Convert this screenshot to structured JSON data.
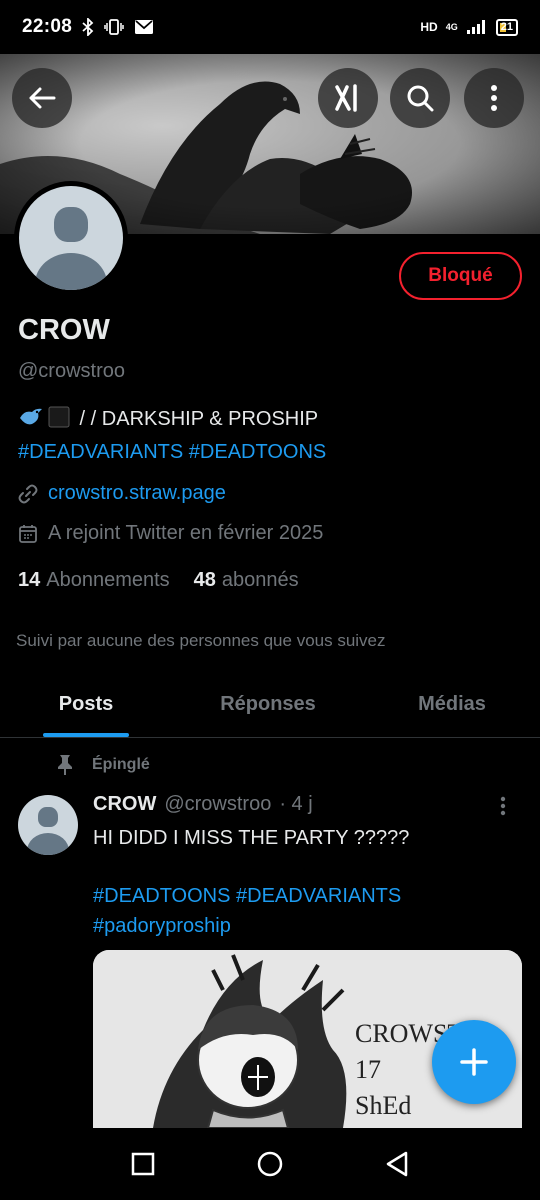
{
  "status_bar": {
    "time": "22:08",
    "network": "HD",
    "signal_type": "4G",
    "battery": "21"
  },
  "header": {
    "icons": {
      "back": "back-arrow-icon",
      "grok": "grok-icon",
      "search": "search-icon",
      "more": "more-vertical-icon"
    }
  },
  "profile": {
    "display_name": "CROW",
    "handle": "@crowstroo",
    "blocked_label": "Bloqué",
    "bio_text": " / / DARKSHIP & PROSHIP",
    "bio_tags": "#DEADVARIANTS #DEADTOONS",
    "link": "crowstro.straw.page",
    "joined": "A rejoint Twitter en février 2025",
    "following_count": "14",
    "following_label": "Abonnements",
    "followers_count": "48",
    "followers_label": "abonnés",
    "followed_by": "Suivi par aucune des personnes que vous suivez"
  },
  "tabs": [
    {
      "label": "Posts",
      "active": true
    },
    {
      "label": "Réponses",
      "active": false
    },
    {
      "label": "Médias",
      "active": false
    }
  ],
  "post": {
    "pinned_label": "Épinglé",
    "author_name": "CROW",
    "author_handle": "@crowstroo",
    "time": "· 4 j",
    "text": "HI DIDD I MISS THE PARTY ?????",
    "tags": "#DEADTOONS #DEADVARIANTS #padoryproship",
    "media_text": [
      "CROWST",
      "17",
      "ShEd"
    ]
  },
  "colors": {
    "accent": "#1d9bf0",
    "blocked": "#f4212e",
    "secondary_text": "#71767b",
    "background": "#000000"
  }
}
